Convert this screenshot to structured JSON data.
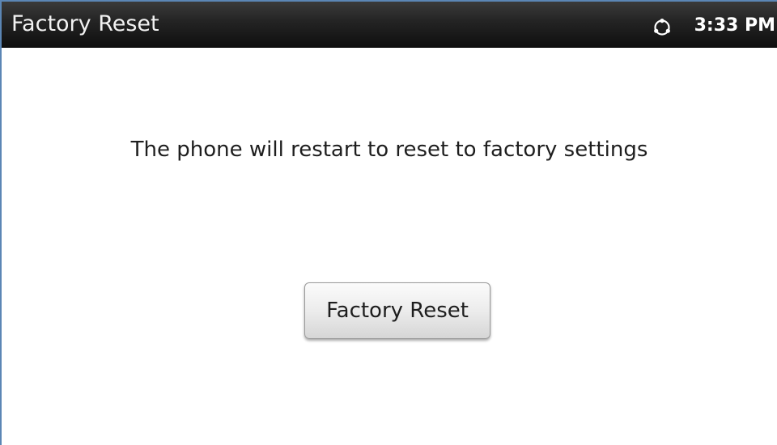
{
  "header": {
    "title": "Factory Reset",
    "status_icon": "sync-circle-icon",
    "time": "3:33 PM"
  },
  "main": {
    "message": "The phone will restart to reset to factory settings",
    "reset_button_label": "Factory Reset"
  },
  "colors": {
    "titlebar": "#1a1a1a",
    "title_text": "#f2f2f2",
    "frame_border": "#5b86b5",
    "body_text": "#1e1e1e"
  }
}
